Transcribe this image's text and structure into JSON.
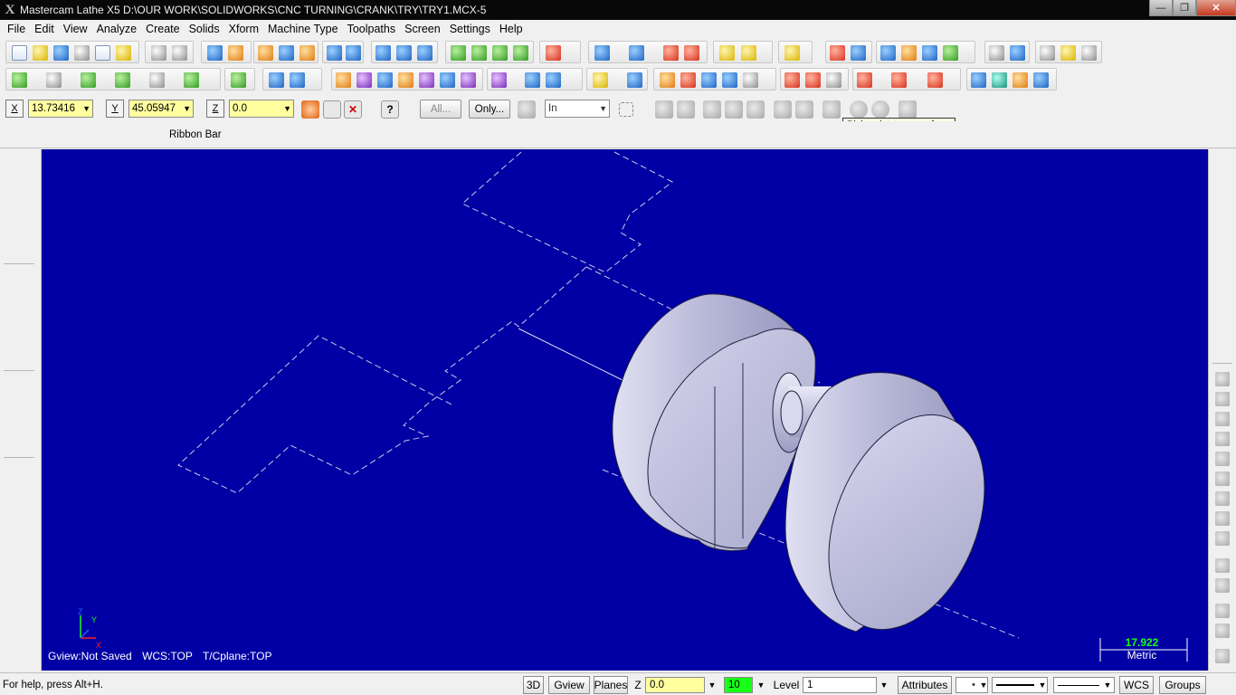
{
  "window": {
    "title": "Mastercam Lathe X5  D:\\OUR WORK\\SOLIDWORKS\\CNC TURNING\\CRANK\\TRY\\TRY1.MCX-5",
    "app_icon": "X",
    "buttons": [
      "minimize-icon",
      "maximize-icon",
      "close-icon"
    ]
  },
  "menu": [
    "File",
    "Edit",
    "View",
    "Analyze",
    "Create",
    "Solids",
    "Xform",
    "Machine Type",
    "Toolpaths",
    "Screen",
    "Settings",
    "Help"
  ],
  "ribbon": {
    "x_label": "X",
    "x_value": "13.73416",
    "y_label": "Y",
    "y_value": "45.05947",
    "z_label": "Z",
    "z_value": "0.0",
    "all_button": "All...",
    "only_button": "Only...",
    "in_select": "In",
    "bar_label": "Ribbon Bar",
    "tooltip": "Pick point to zoom from"
  },
  "viewport": {
    "gview": "Gview:Not Saved",
    "wcs": "WCS:TOP",
    "tcplane": "T/Cplane:TOP",
    "scale_value": "17.922",
    "scale_unit": "Metric",
    "axis_labels": [
      "Z",
      "Y",
      "X"
    ],
    "background": "#0000a4"
  },
  "status": {
    "help": "For help, press Alt+H.",
    "btn_3d": "3D",
    "btn_gview": "Gview",
    "btn_planes": "Planes",
    "z_label": "Z",
    "z_value": "0.0",
    "color_value": "10",
    "level_label": "Level",
    "level_value": "1",
    "attributes": "Attributes",
    "wcs": "WCS",
    "groups": "Groups"
  }
}
